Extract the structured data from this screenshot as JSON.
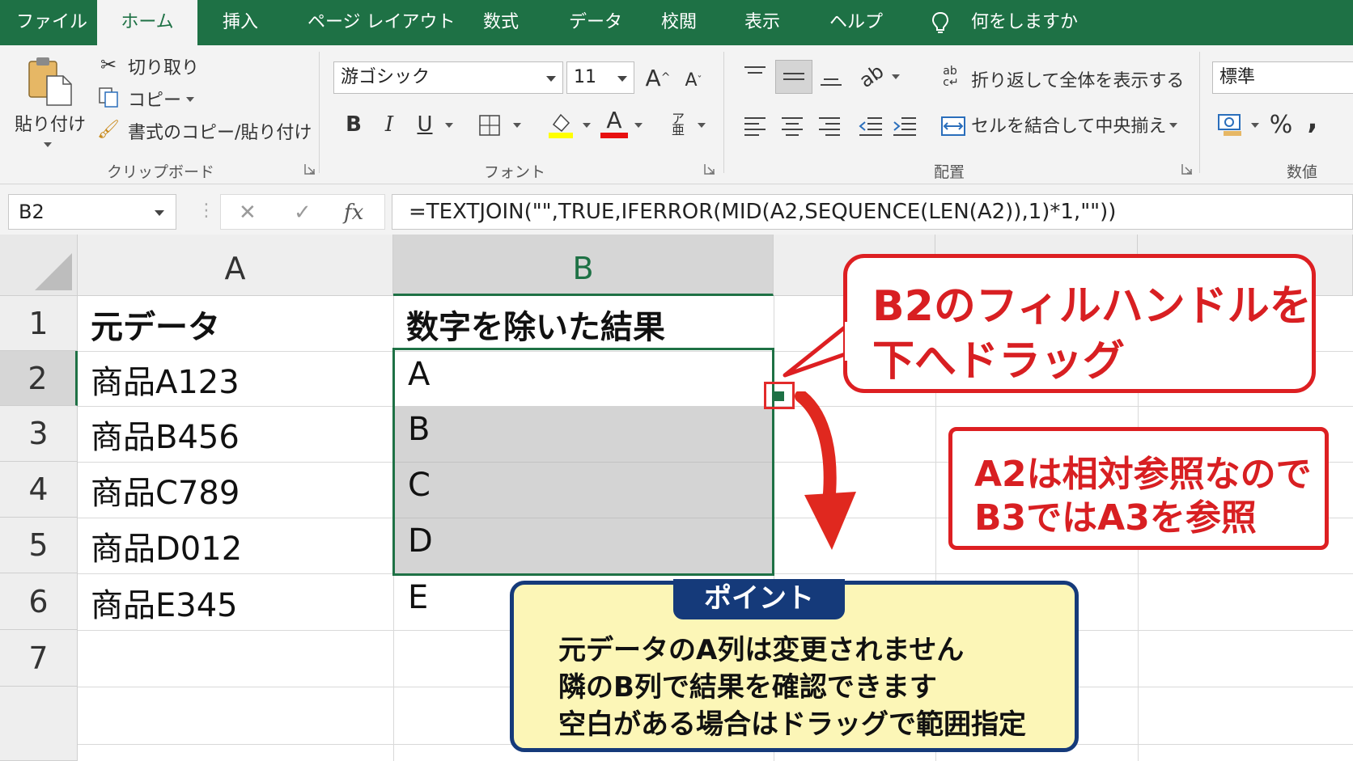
{
  "menu": {
    "tabs": [
      "ファイル",
      "ホーム",
      "挿入",
      "ページ レイアウト",
      "数式",
      "データ",
      "校閲",
      "表示",
      "ヘルプ"
    ],
    "tell_me": "何をしますか"
  },
  "ribbon": {
    "clipboard": {
      "paste": "貼り付け",
      "cut": "切り取り",
      "copy": "コピー",
      "format_painter": "書式のコピー/貼り付け",
      "group_label": "クリップボード"
    },
    "font": {
      "font_name": "游ゴシック",
      "font_size": "11",
      "grow": "A",
      "shrink": "A",
      "bold": "B",
      "italic": "I",
      "underline": "U",
      "font_color_letter": "A",
      "fill_color": "#ffff00",
      "font_color": "#e81010",
      "group_label": "フォント"
    },
    "alignment": {
      "wrap_text": "折り返して全体を表示する",
      "merge_center": "セルを結合して中央揃え",
      "group_label": "配置"
    },
    "number": {
      "format": "標準",
      "percent": "%",
      "comma": ",",
      "group_label": "数値"
    }
  },
  "formula_bar": {
    "name_box": "B2",
    "fx": "fx",
    "cancel": "✕",
    "enter": "✓",
    "formula": "=TEXTJOIN(\"\",TRUE,IFERROR(MID(A2,SEQUENCE(LEN(A2)),1)*1,\"\"))"
  },
  "sheet": {
    "columns": [
      "A",
      "B"
    ],
    "rows": [
      "1",
      "2",
      "3",
      "4",
      "5",
      "6",
      "7"
    ],
    "col_a": [
      "元データ",
      "商品A123",
      "商品B456",
      "商品C789",
      "商品D012",
      "商品E345"
    ],
    "col_b": [
      "数字を除いた結果",
      "A",
      "B",
      "C",
      "D",
      "E"
    ]
  },
  "annotations": {
    "fill_handle": [
      "B2のフィルハンドルを",
      "下へドラッグ"
    ],
    "relative_ref": [
      "A2は相対参照なので",
      "B3ではA3を参照"
    ],
    "point_title": "ポイント",
    "point_lines": [
      "元データのA列は変更されません",
      "隣のB列で結果を確認できます",
      "空白がある場合はドラッグで範囲指定"
    ]
  },
  "colors": {
    "excel_green": "#1e7145",
    "callout_red": "#dd1f22",
    "point_navy": "#153a7a",
    "point_fill": "#fcf6b7"
  }
}
